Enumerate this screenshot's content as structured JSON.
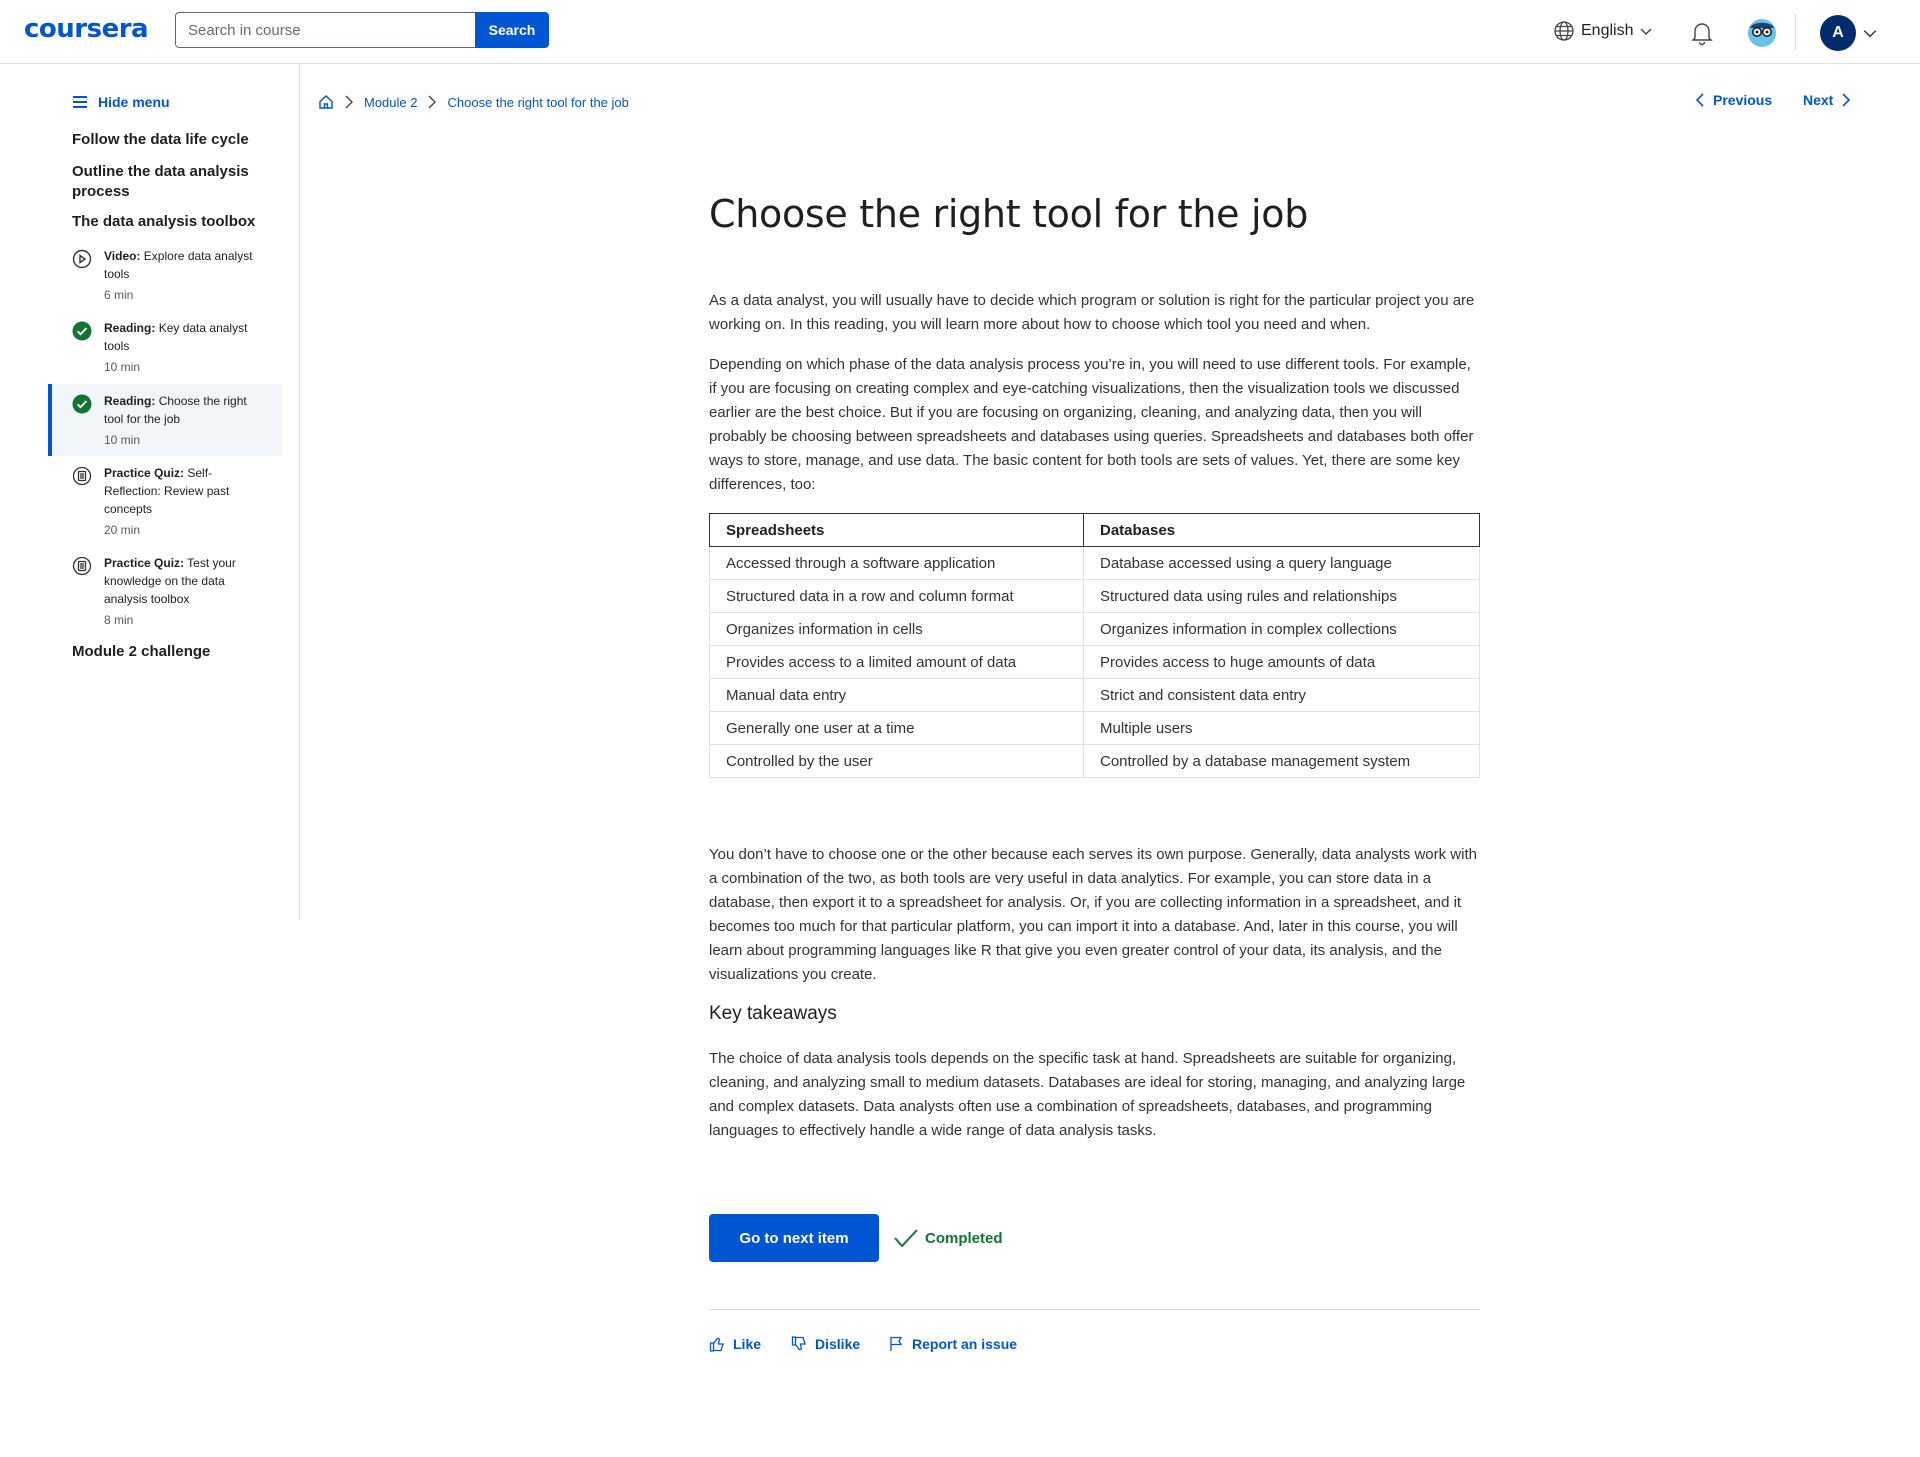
{
  "header": {
    "logo": "coursera",
    "search_placeholder": "Search in course",
    "search_button": "Search",
    "language": "English",
    "avatar_initial": "A"
  },
  "sidebar": {
    "hide_menu": "Hide menu",
    "sections": [
      "Follow the data life cycle",
      "Outline the data analysis process",
      "The data analysis toolbox"
    ],
    "items": [
      {
        "type": "Video:",
        "title": "Explore data analyst tools",
        "duration": "6 min",
        "icon": "play-icon",
        "status": "not-started"
      },
      {
        "type": "Reading:",
        "title": "Key data analyst tools",
        "duration": "10 min",
        "icon": "check-icon",
        "status": "completed"
      },
      {
        "type": "Reading:",
        "title": "Choose the right tool for the job",
        "duration": "10 min",
        "icon": "check-icon",
        "status": "completed"
      },
      {
        "type": "Practice Quiz:",
        "title": "Self-Reflection: Review past concepts",
        "duration": "20 min",
        "icon": "quiz-icon",
        "status": "not-started"
      },
      {
        "type": "Practice Quiz:",
        "title": "Test your knowledge on the data analysis toolbox",
        "duration": "8 min",
        "icon": "quiz-icon",
        "status": "not-started"
      }
    ],
    "challenge": "Module 2 challenge"
  },
  "breadcrumb": {
    "module": "Module 2",
    "current": "Choose the right tool for the job"
  },
  "nav": {
    "previous": "Previous",
    "next": "Next"
  },
  "content": {
    "title": "Choose the right tool for the job",
    "intro": "As a data analyst, you will usually have to decide which program or solution is right for the particular project you are working on. In this reading, you will learn more about how to choose which tool you need and when.",
    "para2": "Depending on which phase of the data analysis process you’re in, you will need to use different tools. For example, if you are focusing on creating complex and eye-catching visualizations, then the visualization tools we discussed earlier are the best choice. But if you are focusing on organizing, cleaning, and analyzing data, then you will probably be choosing between spreadsheets and databases using queries. Spreadsheets and databases both offer ways to store, manage, and use data. The basic content for both tools are sets of values. Yet, there are some key differences, too:",
    "table": {
      "headers": [
        "Spreadsheets",
        "Databases"
      ],
      "rows": [
        [
          "Accessed through a software application",
          "Database accessed using a query language"
        ],
        [
          "Structured data in a row and column format",
          "Structured data using rules and relationships"
        ],
        [
          "Organizes information in cells",
          "Organizes information in complex collections"
        ],
        [
          "Provides access to a limited amount of data",
          "Provides access to huge amounts of data"
        ],
        [
          "Manual data entry",
          "Strict and consistent data entry"
        ],
        [
          "Generally one user at a time",
          "Multiple users"
        ],
        [
          "Controlled by the user",
          "Controlled by a database management system"
        ]
      ]
    },
    "para3": "You don’t have to choose one or the other because each serves its own purpose. Generally, data analysts work with a combination of the two, as both tools are very useful in data analytics. For example, you can store data in a database, then export it to a spreadsheet for analysis. Or, if you are collecting information in a spreadsheet, and it becomes too much for that particular platform, you can import it into a database. And, later in this course, you will learn about programming languages like R that give you even greater control of your data, its analysis, and the visualizations you create.",
    "takeaways_heading": "Key takeaways",
    "takeaways": "The choice of data analysis tools depends on the specific task at hand. Spreadsheets are suitable for organizing, cleaning, and analyzing small to medium datasets. Databases are ideal for storing, managing, and analyzing large and complex datasets. Data analysts often use a combination of spreadsheets, databases, and programming languages to effectively handle a wide range of data analysis tasks."
  },
  "actions": {
    "next_item": "Go to next item",
    "completed": "Completed",
    "like": "Like",
    "dislike": "Dislike",
    "report": "Report an issue"
  },
  "colors": {
    "brand": "#0056d2",
    "complete_green": "#137333"
  }
}
